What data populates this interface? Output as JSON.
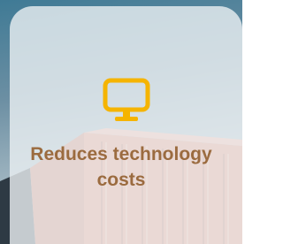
{
  "feature": {
    "title": "Reduces technology costs",
    "icon": "monitor-icon"
  },
  "colors": {
    "icon": "#f5b400",
    "title": "#9b6b3f",
    "card_overlay": "rgba(235,240,242,0.80)",
    "container": "#e77b5f"
  }
}
